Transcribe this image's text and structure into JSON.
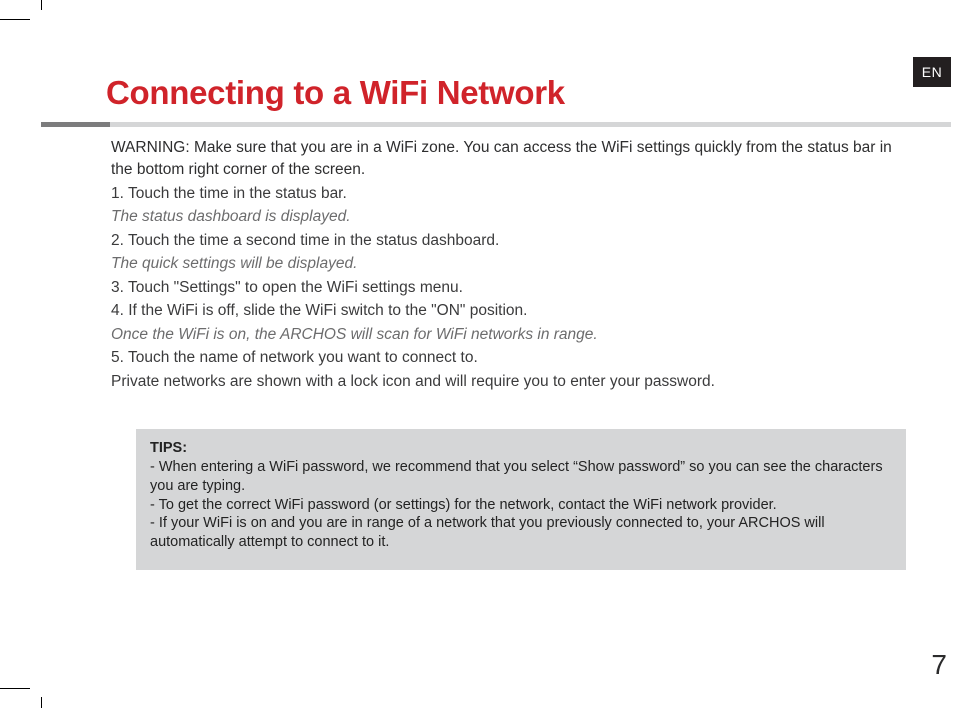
{
  "lang_tab": "EN",
  "title": "Connecting to a WiFi Network",
  "warning": "WARNING:  Make sure that you are in a WiFi zone. You can access the WiFi settings quickly from the status bar in the bottom right corner of the screen.",
  "step1": "1. Touch the time in the status bar.",
  "result1": "The status dashboard is displayed.",
  "step2": "2. Touch the time a second time in the status dashboard.",
  "result2": "The quick settings will be displayed.",
  "step3": "3. Touch \"Settings\" to open the WiFi settings menu.",
  "step4": "4. If the WiFi is off, slide the WiFi switch to the \"ON\" position.",
  "result4": "Once the WiFi is on, the ARCHOS will scan for WiFi networks in range.",
  "step5": "5. Touch the name of network you want to connect to.",
  "note5": "Private networks are shown with a lock icon and will require you to enter your password.",
  "tips_title": "TIPS:",
  "tip1": "-   When entering a WiFi password, we recommend that you select “Show password” so you can see the characters you are typing.",
  "tip2": "-   To get the correct WiFi password (or settings) for the network, contact the WiFi network provider.",
  "tip3": "-   If your WiFi is on and you are in range of a network that you previously connected to, your ARCHOS will automatically attempt to connect to it.",
  "page_number": "7"
}
